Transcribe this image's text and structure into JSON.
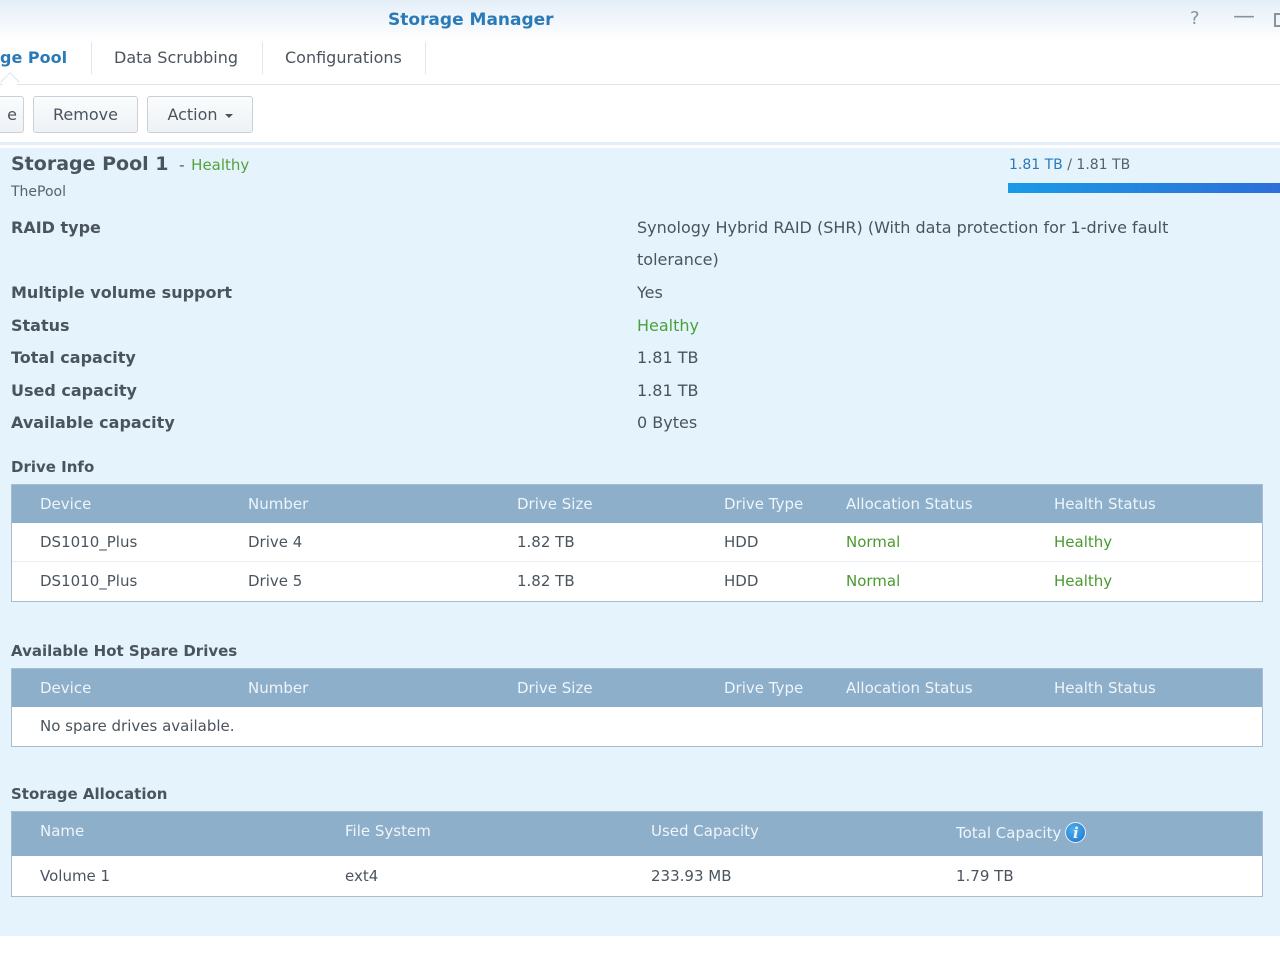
{
  "window": {
    "title": "Storage Manager",
    "controls": {
      "help": "?",
      "minimize": "—"
    }
  },
  "tabs": [
    {
      "label": "ge Pool",
      "active": true
    },
    {
      "label": "Data Scrubbing",
      "active": false
    },
    {
      "label": "Configurations",
      "active": false
    }
  ],
  "toolbar": {
    "partial_button_label": "e",
    "remove_label": "Remove",
    "action_label": "Action"
  },
  "pool": {
    "name": "Storage Pool 1",
    "separator": "-",
    "health": "Healthy",
    "description": "ThePool",
    "usage_text_used": "1.81 TB",
    "usage_text_sep": " / ",
    "usage_text_total": "1.81 TB",
    "usage_fraction": 1.0,
    "colors": {
      "healthy": "#4aa13a",
      "accent": "#2a7ab8",
      "bar": "#1a9be6"
    }
  },
  "properties": [
    {
      "label": "RAID type",
      "value": "Synology Hybrid RAID (SHR) (With data protection for 1-drive fault tolerance)"
    },
    {
      "label": "Multiple volume support",
      "value": "Yes"
    },
    {
      "label": "Status",
      "value": "Healthy"
    },
    {
      "label": "Total capacity",
      "value": "1.81 TB"
    },
    {
      "label": "Used capacity",
      "value": "1.81 TB"
    },
    {
      "label": "Available capacity",
      "value": "0 Bytes"
    }
  ],
  "drive_info": {
    "title": "Drive Info",
    "columns": [
      "Device",
      "Number",
      "Drive Size",
      "Drive Type",
      "Allocation Status",
      "Health Status"
    ],
    "rows": [
      [
        "DS1010_Plus",
        "Drive 4",
        "1.82 TB",
        "HDD",
        "Normal",
        "Healthy"
      ],
      [
        "DS1010_Plus",
        "Drive 5",
        "1.82 TB",
        "HDD",
        "Normal",
        "Healthy"
      ]
    ]
  },
  "hot_spare": {
    "title": "Available Hot Spare Drives",
    "columns": [
      "Device",
      "Number",
      "Drive Size",
      "Drive Type",
      "Allocation Status",
      "Health Status"
    ],
    "empty_text": "No spare drives available."
  },
  "allocation": {
    "title": "Storage Allocation",
    "columns": [
      "Name",
      "File System",
      "Used Capacity",
      "Total Capacity"
    ],
    "info_icon": "i",
    "rows": [
      [
        "Volume 1",
        "ext4",
        "233.93 MB",
        "1.79 TB"
      ]
    ]
  }
}
